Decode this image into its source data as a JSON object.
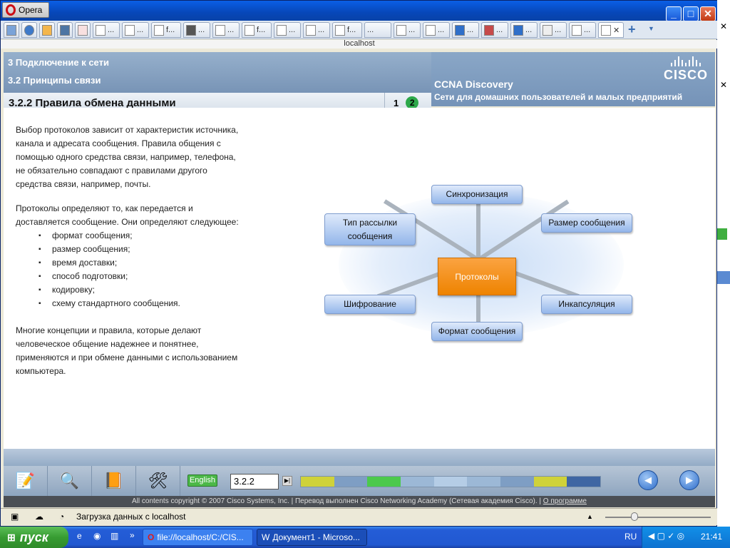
{
  "browser": {
    "name": "Opera",
    "url": "localhost",
    "tabs": [
      "",
      "",
      "",
      "",
      "",
      "",
      "...",
      "f...",
      "...",
      "...",
      "f...",
      "...",
      "...",
      "f...",
      "...",
      "...",
      "...",
      "...",
      "...",
      "...",
      "...",
      "...",
      "..."
    ],
    "new_tab_label": "+",
    "status": "Загрузка данных с localhost"
  },
  "header": {
    "chapter": "3 Подключение к сети",
    "section": "3.2 Принципы связи",
    "title": "3.2.2 Правила обмена данными",
    "page_1": "1",
    "page_2": "2",
    "course": "CCNA Discovery",
    "course_sub": "Сети для домашних пользователей и малых предприятий",
    "logo": "CISCO"
  },
  "content": {
    "p1": "Выбор протоколов зависит от характеристик источника, канала и адресата сообщения. Правила общения с помощью одного средства связи, например, телефона, не обязательно совпадают с правилами другого средства связи, например, почты.",
    "p2": "Протоколы определяют то, как передается и доставляется сообщение. Они определяют следующее:",
    "list": [
      "формат сообщения;",
      "размер сообщения;",
      "время доставки;",
      "способ подготовки;",
      "кодировку;",
      "схему стандартного сообщения."
    ],
    "p3": "Многие концепции и правила, которые делают человеческое общение надежнее и понятнее, применяются и при обмене данными с использованием компьютера."
  },
  "diagram": {
    "center": "Протоколы",
    "top": "Синхронизация",
    "top_left": "Тип рассылки сообщения",
    "top_right": "Размер сообщения",
    "bottom_left": "Шифрование",
    "bottom_right": "Инкапсуляция",
    "bottom": "Формат сообщения"
  },
  "toolbar": {
    "language": "English",
    "page_number": "3.2.2",
    "progress_colors": [
      "#cfd23a",
      "#7e9ec4",
      "#4cc94c",
      "#9cb8d6",
      "#b5cde6",
      "#9cb8d6",
      "#7e9ec4",
      "#cfd23a",
      "#3f66a3"
    ]
  },
  "footer": {
    "copyright": "All contents copyright © 2007 Cisco Systems, Inc. | Перевод выполнен Cisco Networking Academy (Сетевая академия Cisco). |",
    "about": "О программе"
  },
  "taskbar": {
    "start": "пуск",
    "item1": "file://localhost/C:/CIS...",
    "item2": "Документ1 - Microso...",
    "lang": "RU",
    "time": "21:41"
  }
}
